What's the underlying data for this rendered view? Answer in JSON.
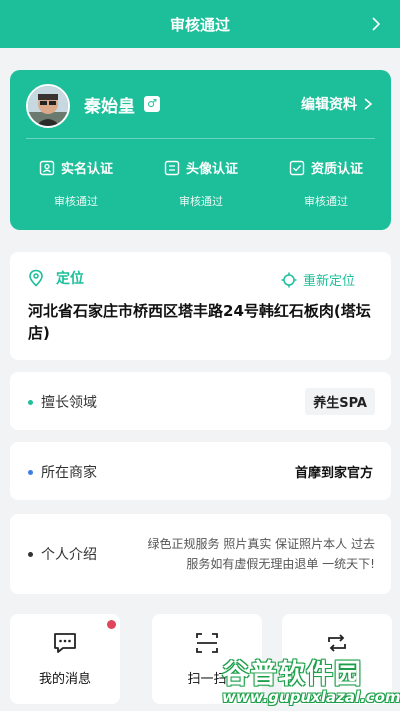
{
  "header": {
    "title": "审核通过",
    "back_icon": "chevron-right-icon"
  },
  "profile": {
    "name": "秦始皇",
    "gender_symbol": "♂",
    "edit_label": "编辑资料",
    "certifications": [
      {
        "label": "实名认证",
        "status": "审核通过",
        "icon": "id-card-icon"
      },
      {
        "label": "头像认证",
        "status": "审核通过",
        "icon": "portrait-card-icon"
      },
      {
        "label": "资质认证",
        "status": "审核通过",
        "icon": "check-box-icon"
      }
    ]
  },
  "location": {
    "label": "定位",
    "relocate_label": "重新定位",
    "address": "河北省石家庄市桥西区塔丰路24号韩红石板肉(塔坛店)"
  },
  "skills": {
    "label": "擅长领域",
    "value": "养生SPA"
  },
  "merchant": {
    "label": "所在商家",
    "value": "首摩到家官方"
  },
  "intro": {
    "label": "个人介绍",
    "text": "绿色正规服务 照片真实 保证照片本人 过去服务如有虚假无理由退单 一统天下!"
  },
  "tiles": [
    {
      "label": "我的消息",
      "icon": "message-icon",
      "has_badge": true
    },
    {
      "label": "扫一扫",
      "icon": "scan-icon",
      "has_badge": false
    },
    {
      "label": "",
      "icon": "refresh-icon",
      "has_badge": false
    }
  ],
  "watermark": {
    "title": "谷普软件园",
    "url": "www.gupuxlazal.com"
  },
  "colors": {
    "brand": "#1cbf9a",
    "badge": "#e0465a",
    "background": "#f2f3f5"
  }
}
